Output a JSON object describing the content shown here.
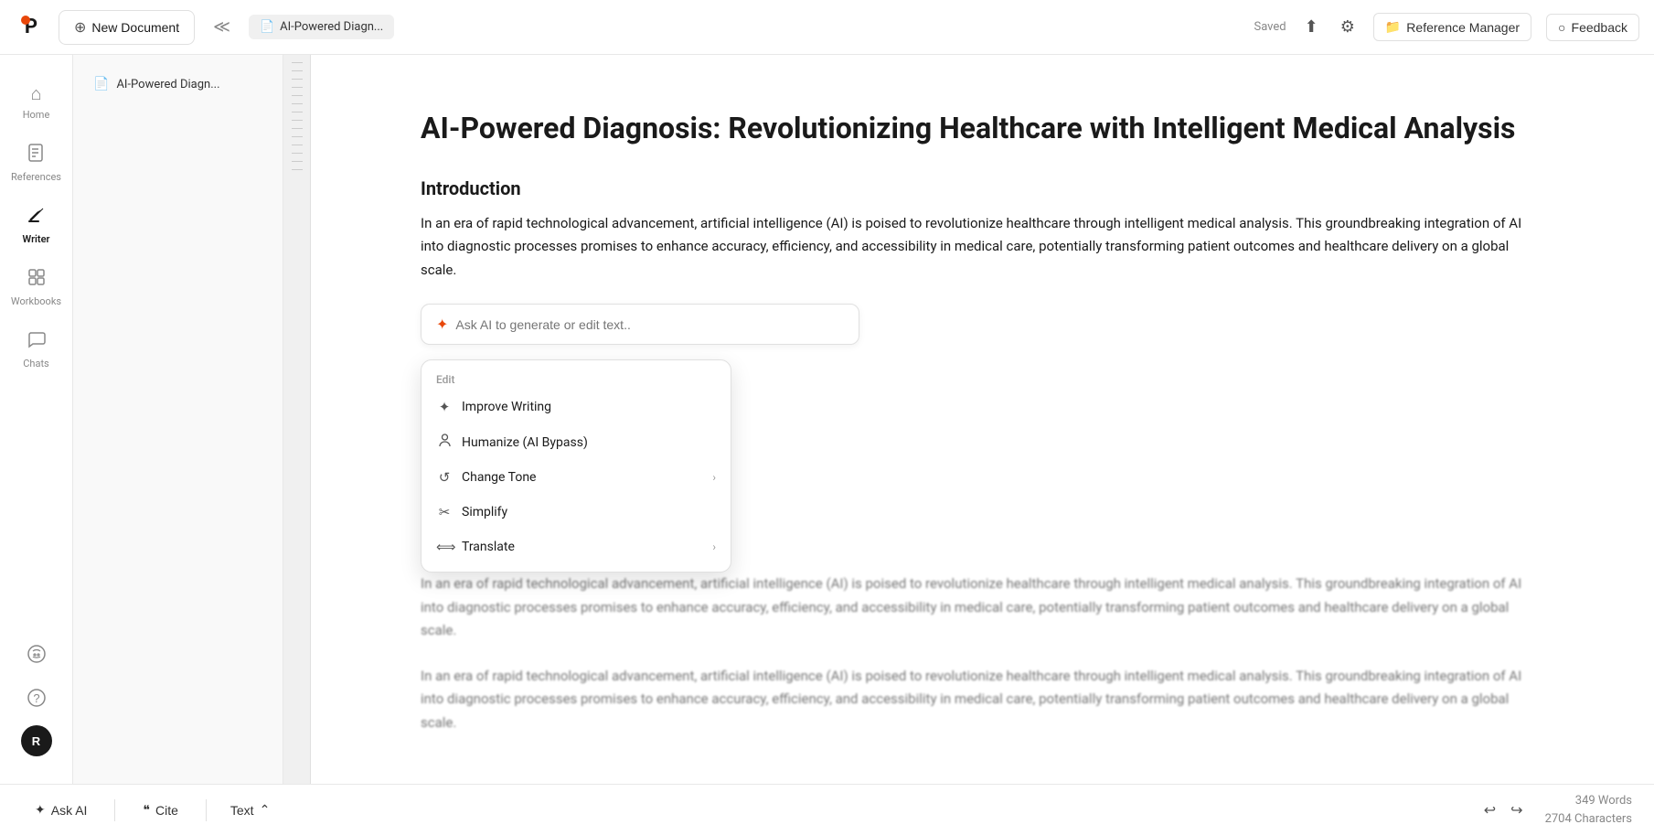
{
  "topbar": {
    "logo_letter": "P",
    "new_doc_label": "New Document",
    "doc_tab_name": "AI-Powered Diagn...",
    "saved_label": "Saved",
    "reference_manager_label": "Reference Manager",
    "feedback_label": "Feedback"
  },
  "sidebar": {
    "items": [
      {
        "id": "home",
        "label": "Home",
        "icon": "⌂"
      },
      {
        "id": "references",
        "label": "References",
        "icon": "📁"
      },
      {
        "id": "writer",
        "label": "Writer",
        "icon": "✏️",
        "active": true
      },
      {
        "id": "workbooks",
        "label": "Workbooks",
        "icon": "📋"
      },
      {
        "id": "chats",
        "label": "Chats",
        "icon": "💬"
      }
    ],
    "bottom": [
      {
        "id": "discord",
        "icon": "🎮"
      },
      {
        "id": "help",
        "icon": "?"
      },
      {
        "id": "user",
        "label": "R"
      }
    ]
  },
  "document": {
    "title": "AI-Powered Diagnosis: Revolutionizing Healthcare with Intelligent Medical Analysis",
    "sections": [
      {
        "heading": "Introduction",
        "paragraphs": [
          "In an era of rapid technological advancement, artificial intelligence (AI) is poised to revolutionize healthcare through intelligent medical analysis. This groundbreaking integration of AI into diagnostic processes promises to enhance accuracy, efficiency, and accessibility in medical care, potentially transforming patient outcomes and healthcare delivery on a global scale.",
          "In an era of rapid technological advancement, artificial intelligence (AI) is poised to revolutionize healthcare through intelligent medical analysis. This groundbreaking integration of AI into diagnostic processes promises to enhance accuracy, efficiency, and accessibility in medical care, potentially transforming patient outcomes and healthcare delivery on a global scale.",
          "In an era of rapid technological advancement, artificial intelligence (AI) is poised to revolutionize healthcare through intelligent medical analysis. This groundbreaking integration of AI into diagnostic processes promises to enhance accuracy, efficiency, and accessibility in medical care, potentially transforming patient outcomes and healthcare delivery on a global scale."
        ]
      }
    ]
  },
  "ai_input": {
    "placeholder": "Ask AI to generate or edit text.."
  },
  "dropdown": {
    "section_label": "Edit",
    "items": [
      {
        "id": "improve-writing",
        "label": "Improve Writing",
        "icon": "✦",
        "has_chevron": false
      },
      {
        "id": "humanize",
        "label": "Humanize (AI Bypass)",
        "icon": "👤",
        "has_chevron": false
      },
      {
        "id": "change-tone",
        "label": "Change Tone",
        "icon": "↺",
        "has_chevron": true
      },
      {
        "id": "simplify",
        "label": "Simplify",
        "icon": "✂",
        "has_chevron": false
      },
      {
        "id": "translate",
        "label": "Translate",
        "icon": "⟺",
        "has_chevron": true
      }
    ]
  },
  "bottom_toolbar": {
    "ask_ai_label": "Ask AI",
    "cite_label": "Cite",
    "text_label": "Text",
    "words": "349 Words",
    "characters": "2704 Characters"
  }
}
